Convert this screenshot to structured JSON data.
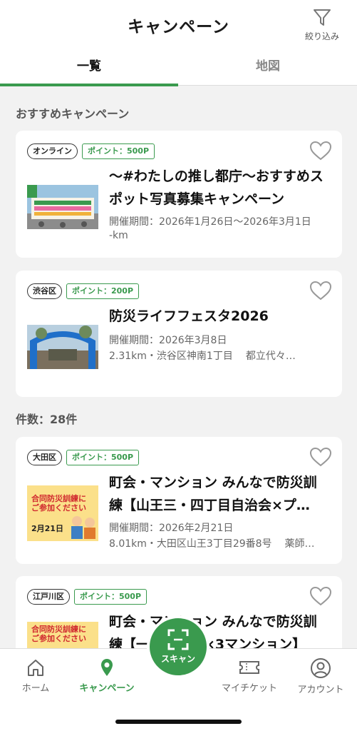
{
  "header": {
    "title": "キャンペーン",
    "filter_label": "絞り込み"
  },
  "tabs": [
    {
      "label": "一覧",
      "active": true
    },
    {
      "label": "地図",
      "active": false
    }
  ],
  "recommended": {
    "heading": "おすすめキャンペーン",
    "cards": [
      {
        "area_tag": "オンライン",
        "point_tag": "ポイント：500P",
        "title": "〜#わたしの推し都庁〜おすすめスポット写真募集キャンペーン",
        "period": "開催期間：2026年1月26日〜2026年3月1日",
        "distance": "-km",
        "venue": ""
      },
      {
        "area_tag": "渋谷区",
        "point_tag": "ポイント：200P",
        "title": "防災ライフフェスタ2026",
        "period": "開催期間：2026年3月8日",
        "distance": "2.31km・渋谷区神南1丁目",
        "venue": "都立代々…"
      }
    ]
  },
  "results": {
    "count_label": "件数：28件",
    "cards": [
      {
        "area_tag": "大田区",
        "point_tag": "ポイント：500P",
        "title": "町会・マンション みんなで防災訓練【山王三・四丁目自治会×プ…",
        "period": "開催期間：2026年2月21日",
        "distance": "8.01km・大田区山王3丁目29番8号",
        "venue": "薬師…"
      },
      {
        "area_tag": "江戸川区",
        "point_tag": "ポイント：500P",
        "title": "町会・マンション みんなで防災訓練【一　　　　×3マンション】",
        "period": "",
        "distance": "",
        "venue": ""
      }
    ]
  },
  "thumb_text": {
    "poster_line1": "合同防災訓練に",
    "poster_line2": "ご参加ください",
    "poster_date": "2月21日"
  },
  "bottom_nav": {
    "home": "ホーム",
    "campaign": "キャンペーン",
    "scan": "スキャン",
    "ticket": "マイチケット",
    "account": "アカウント"
  },
  "colors": {
    "accent": "#3a9a4e",
    "background": "#f2f2f2"
  }
}
